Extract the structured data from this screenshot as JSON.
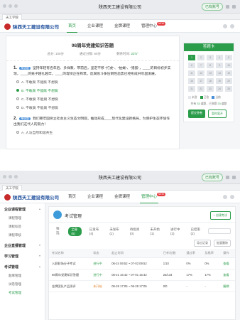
{
  "browser": {
    "site_title": "陕西天工建设有限公司",
    "tab_label": "天工学院",
    "login_label": "已有账号"
  },
  "company": {
    "name": "陕西天工建设有限公司"
  },
  "nav": {
    "items": [
      "首页",
      "企业课程",
      "金牌课程",
      "管理中心"
    ],
    "new_badge": "NEW"
  },
  "exam": {
    "title": "98周年党建知识答题",
    "total_label": "总分: 100分",
    "pass_label": "通过分数: 60分",
    "time_label": "剩余时间:",
    "time_value": "22'5\"",
    "questions": [
      {
        "num": "1.",
        "tag": "单选题",
        "stem": "坚持年轻有名年后、多样教、带前后，坚定不移 “打虎”、“拍蝇”、“猎狐”，____的目标初步实现，____的笼子越扎越牢，____的堤坝正在构筑，反腐败斗争压倒性态势已经形成并巩固发展。",
        "options": [
          {
            "label": "A. 不敢腐 不能腐 不想腐"
          },
          {
            "label": "B. 不敢腐 不能腐 不想腐"
          },
          {
            "label": "C. 不敢腐 不能腐 不想腐"
          },
          {
            "label": "D. 不敢腐 不能腐 不想腐"
          }
        ]
      },
      {
        "num": "2.",
        "tag": "单选题",
        "stem": "我们要牢固树立社会主义生态文明观，推动形成____现代化建设新格局，为保护生态环境作出我们这代人的努力！",
        "options": [
          {
            "label": "A. 人与自然和谐共生"
          }
        ]
      }
    ]
  },
  "answer_card": {
    "title": "答题卡",
    "cells": [
      "1",
      "2",
      "3",
      "4",
      "5",
      "6",
      "7",
      "8",
      "9",
      "10",
      "11",
      "12",
      "13",
      "14",
      "15",
      "16",
      "17",
      "18",
      "19",
      "20",
      "21",
      "22",
      "23",
      "24",
      "25"
    ],
    "done_count": 1,
    "legend": [
      "未答",
      "已答",
      "当前"
    ],
    "progress_prefix": "共有",
    "progress_total": "33",
    "progress_mid": "道题，已答题",
    "progress_done": "33",
    "progress_suffix": "道题",
    "submit_label": "提交答卷",
    "exit_label": "暂时离开"
  },
  "sidebar": {
    "groups": [
      {
        "title": "企业课程管理",
        "items": [
          "课程管理",
          "课程标签",
          "课程审核"
        ]
      },
      {
        "title": "企业直播管理",
        "items": []
      },
      {
        "title": "学习管理",
        "items": []
      },
      {
        "title": "考试管理",
        "items": [
          "题库管理",
          "试卷管理",
          "考试管理"
        ]
      }
    ]
  },
  "exam_mgmt": {
    "title": "考试管理",
    "new_button": "+ 创建考试",
    "filters": [
      "筛选",
      "全部(5)",
      "已发布(4)",
      "未发布(1)",
      "待批阅(0)",
      "未开始(1)",
      "进行中(2)",
      "已结束(2)"
    ],
    "toolbar": [
      "导出记录",
      "批量删除"
    ],
    "columns": [
      "考试名称",
      "状态",
      "起止时间",
      "已考/总数",
      "通过率",
      "及格率",
      "操作"
    ],
    "rows": [
      {
        "name": "入职职场分子考试",
        "status": "进行中",
        "time": "06-24 09:52 ~ 07-03 09:52",
        "count": "1/10",
        "pass": "0%",
        "rate": "0%",
        "op": "查看"
      },
      {
        "name": "98周年党建知识答题",
        "status": "进行中",
        "time": "06-21 15:42 ~ 07-01 15:42",
        "count": "23/134",
        "pass": "17%",
        "rate": "17%",
        "op": "查看"
      },
      {
        "name": "金牌团队产品测评",
        "status": "未开始",
        "time": "06-26 17:05 ~ 06-28 17:05",
        "count": "0/0",
        "pass": "-",
        "rate": "-",
        "op": "编辑"
      }
    ]
  },
  "colors": {
    "brand_green": "#2a9c4a",
    "brand_blue": "#1e4f9c",
    "logo_red": "#c72a2a"
  }
}
